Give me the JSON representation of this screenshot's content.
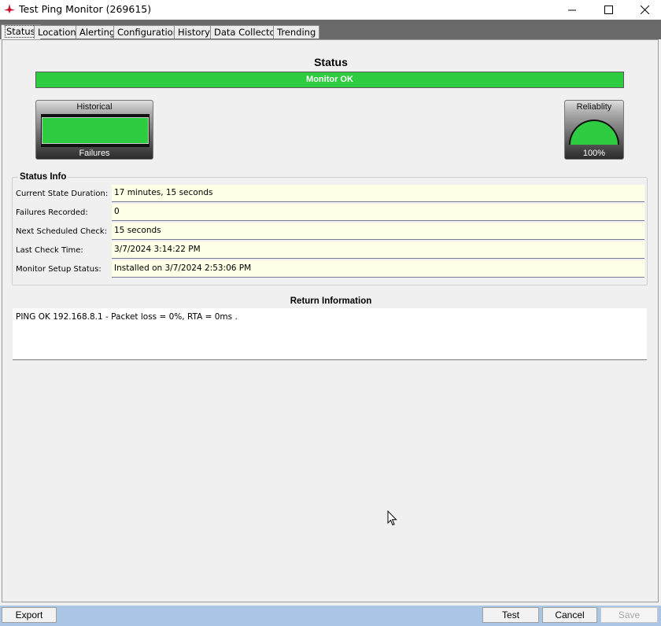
{
  "window": {
    "title": "Test Ping Monitor (269615)",
    "icon": "app-red-icon",
    "controls": [
      "minimize-icon",
      "maximize-icon",
      "close-icon"
    ]
  },
  "tabs": [
    {
      "label": "Status",
      "active": true
    },
    {
      "label": "Location",
      "active": false
    },
    {
      "label": "Alerting",
      "active": false
    },
    {
      "label": "Configuration",
      "active": false
    },
    {
      "label": "History",
      "active": false
    },
    {
      "label": "Data Collector",
      "active": false
    },
    {
      "label": "Trending",
      "active": false
    }
  ],
  "status": {
    "heading": "Status",
    "bar_text": "Monitor OK",
    "bar_color": "#2ecc40"
  },
  "historical": {
    "title": "Historical",
    "caption": "Failures"
  },
  "reliability": {
    "title": "Reliablity",
    "value_text": "100%",
    "value_fraction": 1.0
  },
  "status_info": {
    "legend": "Status Info",
    "rows": [
      {
        "label": "Current State Duration:",
        "value": "17 minutes, 15 seconds"
      },
      {
        "label": "Failures Recorded:",
        "value": "0"
      },
      {
        "label": "Next Scheduled Check:",
        "value": "15 seconds"
      },
      {
        "label": "Last Check Time:",
        "value": "3/7/2024 3:14:22 PM"
      },
      {
        "label": "Monitor Setup Status:",
        "value": "Installed on 3/7/2024 2:53:06 PM"
      }
    ]
  },
  "return_info": {
    "heading": "Return Information",
    "text": "PING OK 192.168.8.1 - Packet loss = 0%, RTA = 0ms ."
  },
  "buttons": {
    "export": "Export",
    "test": "Test",
    "cancel": "Cancel",
    "save": "Save"
  }
}
